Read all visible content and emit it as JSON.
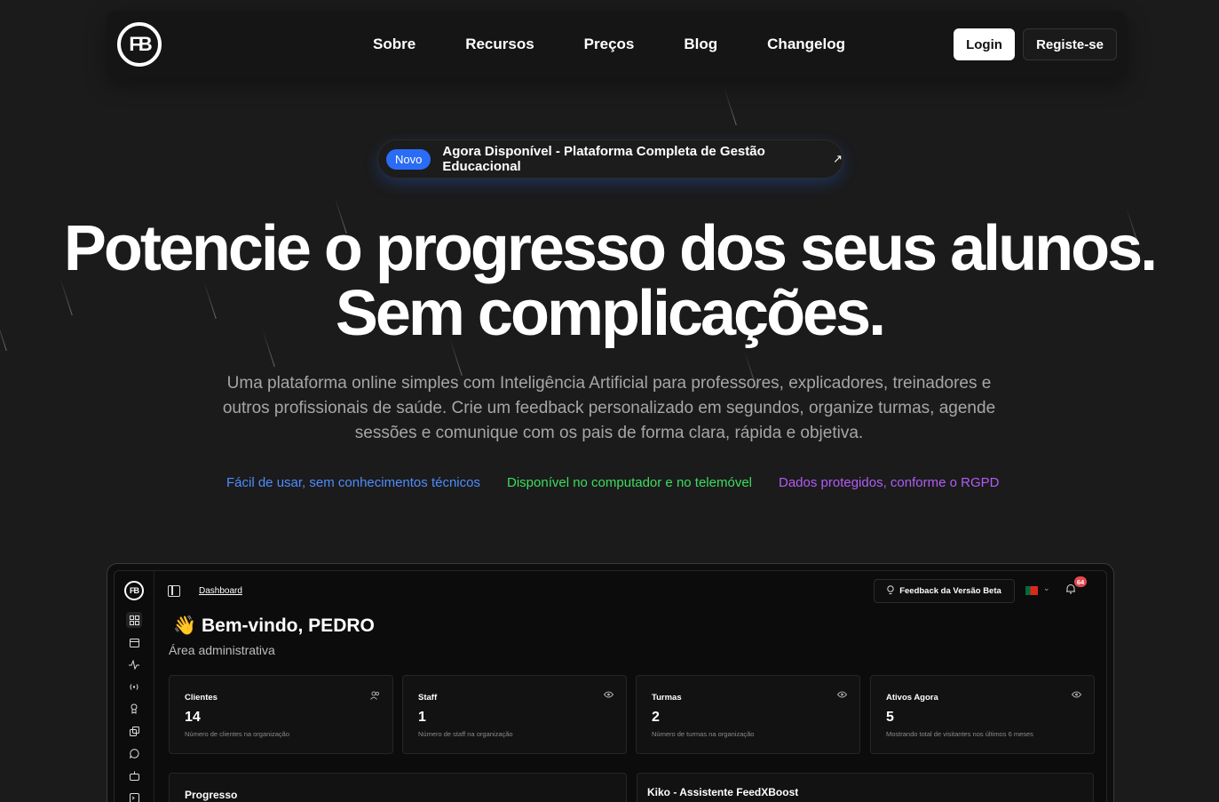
{
  "nav": {
    "logo": "FB",
    "links": [
      "Sobre",
      "Recursos",
      "Preços",
      "Blog",
      "Changelog"
    ],
    "login_label": "Login",
    "signup_label": "Registe-se"
  },
  "announcement": {
    "badge": "Novo",
    "text": "Agora Disponível - Plataforma Completa de Gestão Educacional",
    "arrow": "↗"
  },
  "hero": {
    "title_line1": "Potencie o progresso dos seus alunos.",
    "title_line2": "Sem complicações.",
    "subtitle": "Uma plataforma online simples com Inteligência Artificial para professores, explicadores, treinadores e outros profissionais de saúde. Crie um feedback personalizado em segundos, organize turmas, agende sessões e comunique com os pais de forma clara, rápida e objetiva."
  },
  "features": [
    {
      "text": "Fácil de usar, sem conhecimentos técnicos",
      "color": "#4f8cff"
    },
    {
      "text": "Disponível no computador e no telemóvel",
      "color": "#3ddc5f"
    },
    {
      "text": "Dados protegidos, conforme o RGPD",
      "color": "#b25cf6"
    }
  ],
  "dashboard": {
    "logo": "FB",
    "breadcrumb": "Dashboard",
    "feedback_button": "Feedback da Versão Beta",
    "notification_count": "64",
    "welcome": "Bem-vindo, PEDRO",
    "welcome_emoji": "👋",
    "role": "Área administrativa",
    "sidebar_icons": [
      "grid-icon",
      "calendar-icon",
      "activity-icon",
      "broadcast-icon",
      "award-icon",
      "files-icon",
      "chat-icon",
      "bot-icon",
      "terminal-icon"
    ],
    "cards": [
      {
        "title": "Clientes",
        "value": "14",
        "desc": "Número de clientes na organização",
        "icon": "users-icon"
      },
      {
        "title": "Staff",
        "value": "1",
        "desc": "Número de staff na organização",
        "icon": "eye-icon"
      },
      {
        "title": "Turmas",
        "value": "2",
        "desc": "Número de turmas na organização",
        "icon": "eye-icon"
      },
      {
        "title": "Ativos Agora",
        "value": "5",
        "desc": "Mostrando total de visitantes nos últimos 6 meses",
        "icon": "eye-icon"
      }
    ],
    "panels": [
      "Progresso",
      "Kiko - Assistente FeedXBoost"
    ]
  }
}
